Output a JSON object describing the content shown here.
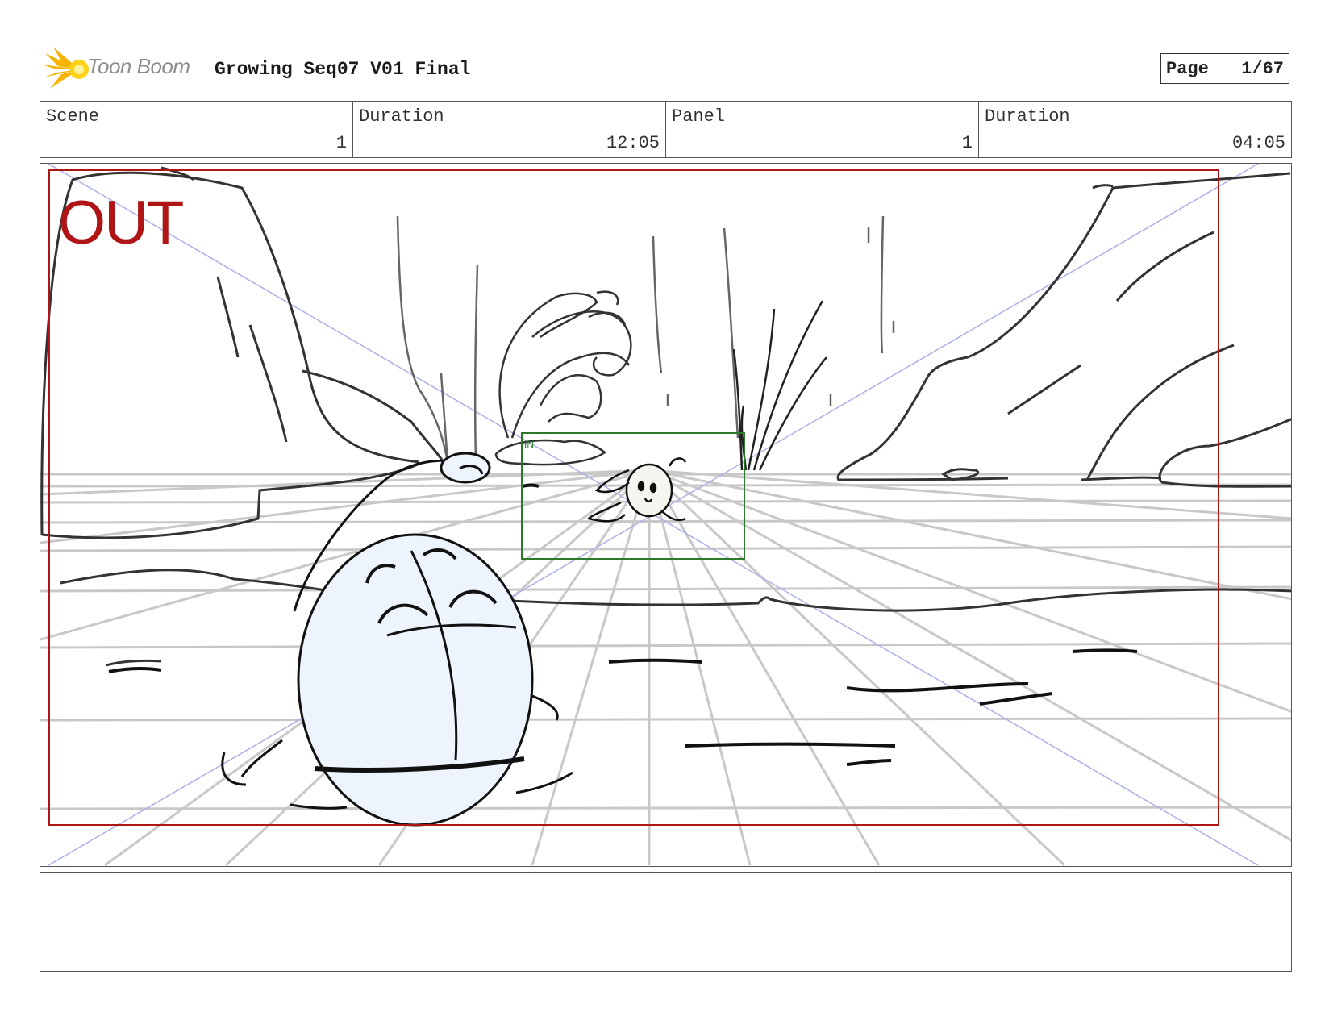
{
  "header": {
    "logo_text": "Toon Boom",
    "title": "Growing Seq07 V01 Final",
    "page_label": "Page",
    "page_number": "1/67"
  },
  "info": {
    "scene_label": "Scene",
    "scene_value": "1",
    "scene_duration_label": "Duration",
    "scene_duration_value": "12:05",
    "panel_label": "Panel",
    "panel_value": "1",
    "panel_duration_label": "Duration",
    "panel_duration_value": "04:05"
  },
  "panel": {
    "camera_out_label": "OUT",
    "camera_in_label": "IN",
    "colors": {
      "out_frame": "#b01515",
      "in_frame": "#2a7a2a",
      "perspective": "#aab0e8",
      "grid": "#c8c8c8",
      "character_fill": "#eef4fd"
    }
  },
  "notes": {
    "text": ""
  }
}
